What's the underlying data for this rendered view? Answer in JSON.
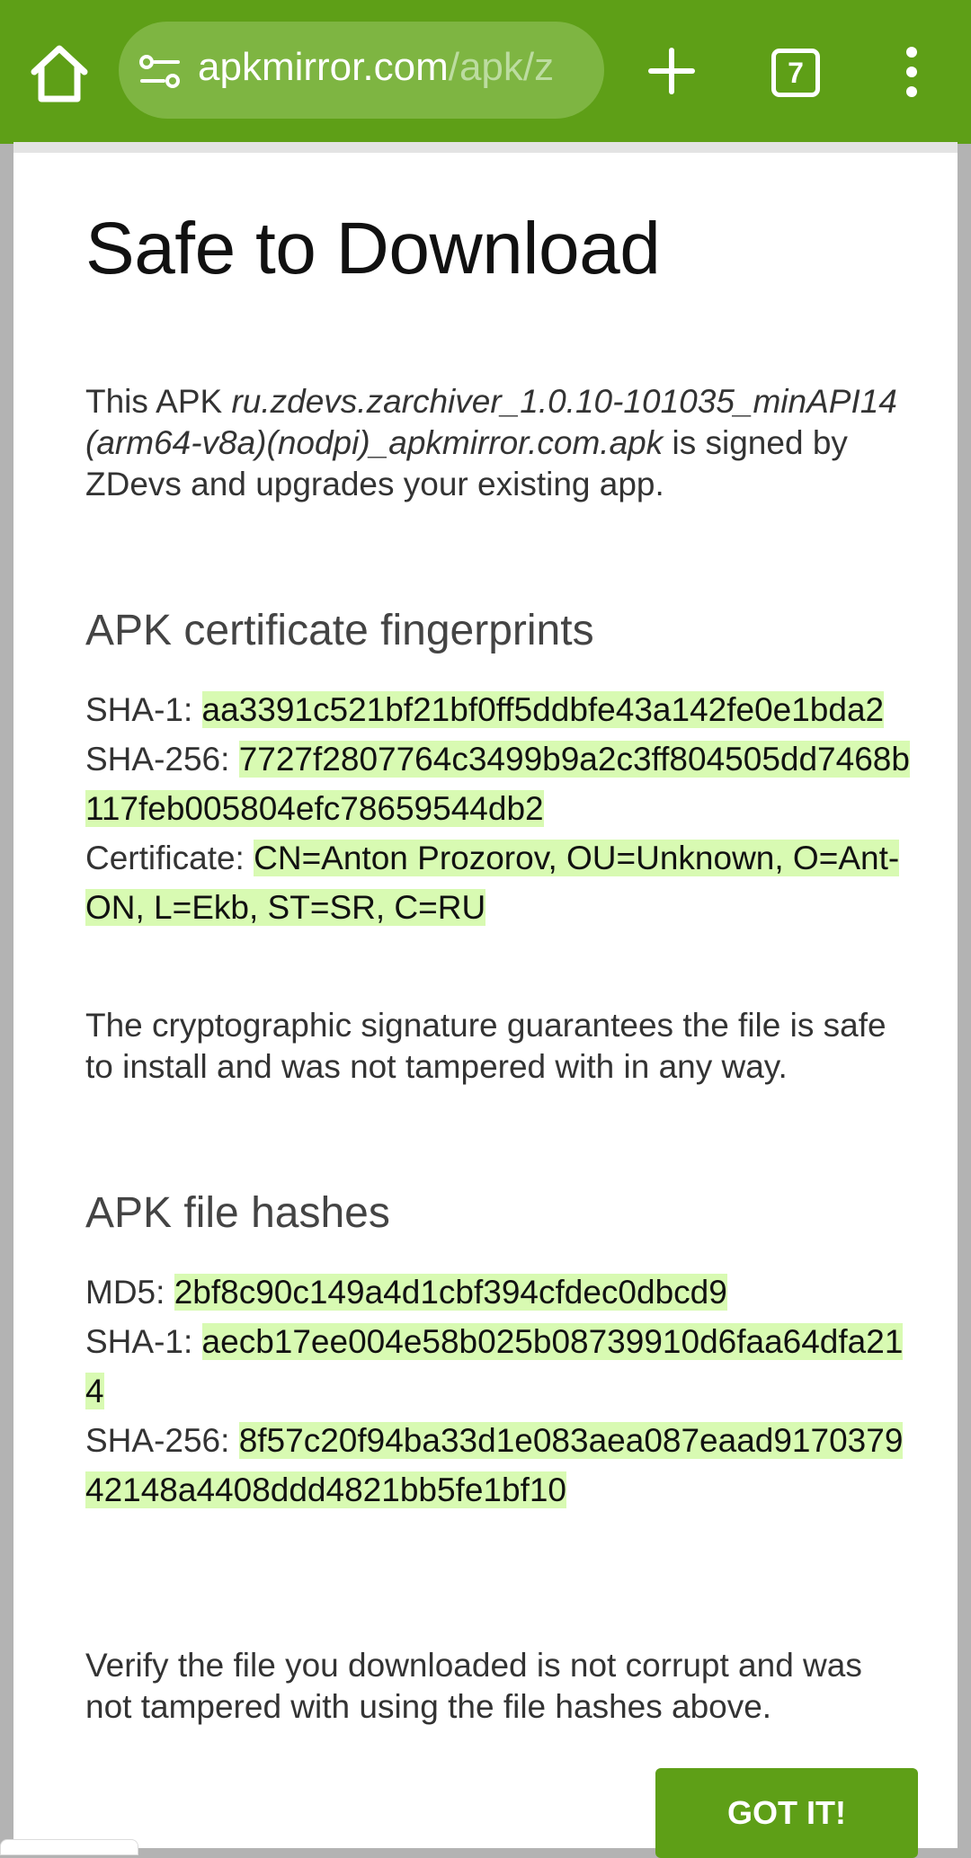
{
  "browser": {
    "url_domain": "apkmirror.com",
    "url_path": "/apk/z",
    "tab_count": "7",
    "icons": [
      "home-icon",
      "site-settings-icon",
      "plus-icon",
      "tabs-icon",
      "more-vert-icon"
    ],
    "colors": {
      "toolbar": "#5e9f17",
      "urlbar": "#7eb542"
    }
  },
  "dialog": {
    "title": "Safe to Download",
    "intro_prefix": "This APK ",
    "intro_filename": "ru.zdevs.zarchiver_1.0.10-101035_minAPI14(arm64-v8a)(nodpi)_apkmirror.com.apk",
    "intro_suffix": " is signed by ZDevs and upgrades your existing app.",
    "cert_heading": "APK certificate fingerprints",
    "cert_rows": [
      {
        "label": "SHA-1: ",
        "value": "aa3391c521bf21bf0ff5ddbfe43a142fe0e1bda2"
      },
      {
        "label": "SHA-256: ",
        "value": "7727f2807764c3499b9a2c3ff804505dd7468b117feb005804efc78659544db2"
      },
      {
        "label": "Certificate: ",
        "value": "CN=Anton Prozorov, OU=Unknown, O=Ant-ON, L=Ekb, ST=SR, C=RU"
      }
    ],
    "cert_note": "The cryptographic signature guarantees the file is safe to install and was not tampered with in any way.",
    "hash_heading": "APK file hashes",
    "hash_rows": [
      {
        "label": "MD5: ",
        "value": "2bf8c90c149a4d1cbf394cfdec0dbcd9"
      },
      {
        "label": "SHA-1: ",
        "value": "aecb17ee004e58b025b08739910d6faa64dfa214"
      },
      {
        "label": "SHA-256: ",
        "value": "8f57c20f94ba33d1e083aea087eaad917037942148a4408ddd4821bb5fe1bf10"
      }
    ],
    "hash_note": "Verify the file you downloaded is not corrupt and was not tampered with using the file hashes above.",
    "button_label": "GOT IT!",
    "colors": {
      "highlight": "#d8fab2",
      "button": "#5e9f17"
    }
  }
}
